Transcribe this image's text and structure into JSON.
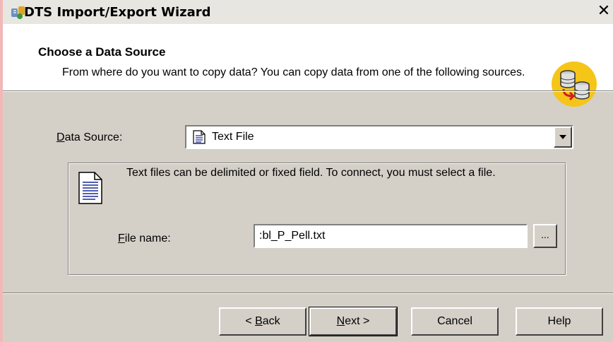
{
  "window": {
    "title": "DTS Import/Export Wizard",
    "close_label": "✕"
  },
  "header": {
    "title": "Choose a Data Source",
    "description": "From where do you want to copy data?  You can copy data from one of the following sources."
  },
  "data_source": {
    "label_prefix": "D",
    "label_rest": "ata Source:",
    "selected": "Text File"
  },
  "group": {
    "info": "Text files can be delimited or fixed field. To connect, you must select a file.",
    "file_label_prefix": "F",
    "file_label_rest": "ile name:",
    "file_value": ":bl_P_Pell.txt",
    "browse_label": "..."
  },
  "buttons": {
    "back_pre": "< ",
    "back_u": "B",
    "back_rest": "ack",
    "next_u": "N",
    "next_rest": "ext >",
    "cancel": "Cancel",
    "help": "Help"
  },
  "colors": {
    "dialog": "#d4d0c8",
    "header_bg": "#ffffff",
    "badge": "#f5c518"
  }
}
